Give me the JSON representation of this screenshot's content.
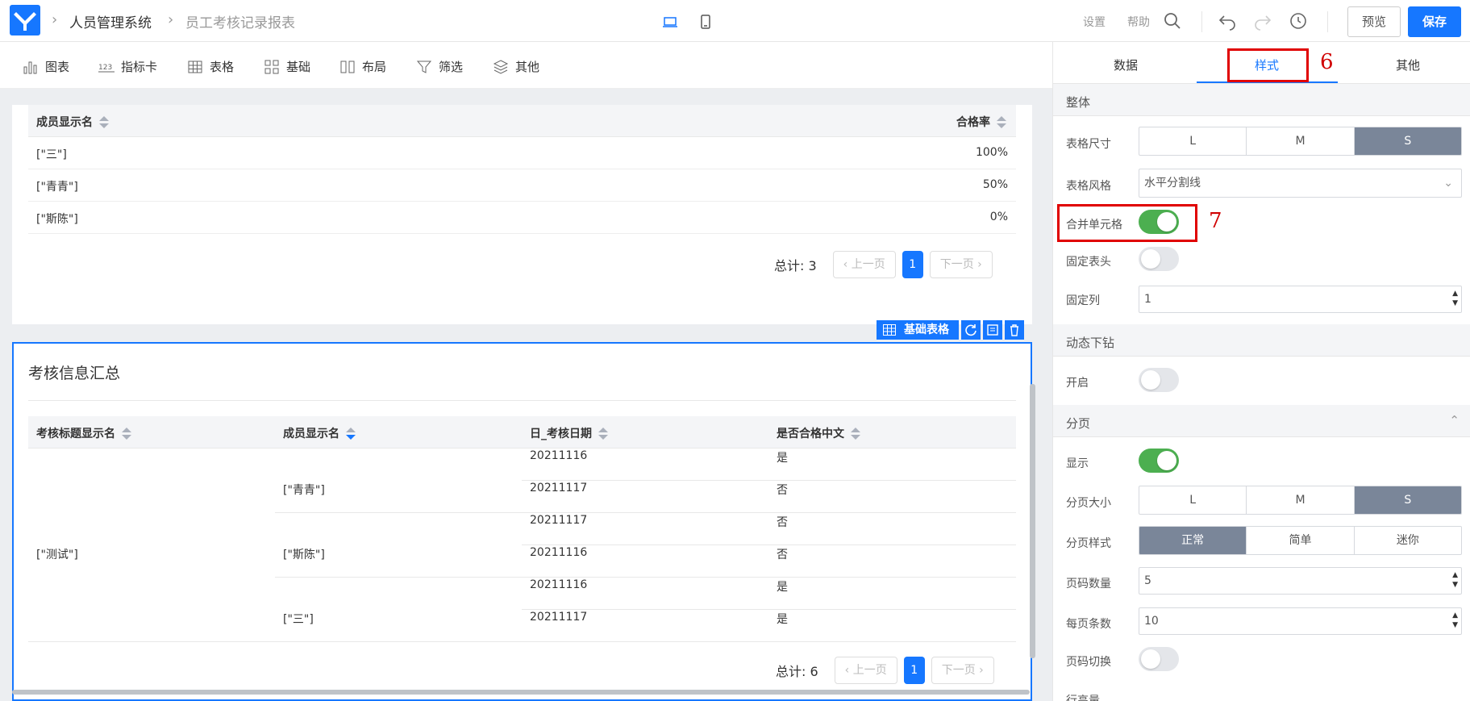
{
  "header": {
    "breadcrumb_app": "人员管理系统",
    "breadcrumb_page": "员工考核记录报表",
    "settings_label": "设置",
    "help_label": "帮助",
    "preview_label": "预览",
    "save_label": "保存"
  },
  "components": [
    {
      "label": "图表",
      "icon": "bar-chart-icon"
    },
    {
      "label": "指标卡",
      "icon": "number-123-icon"
    },
    {
      "label": "表格",
      "icon": "table-grid-icon"
    },
    {
      "label": "基础",
      "icon": "blocks-icon"
    },
    {
      "label": "布局",
      "icon": "columns-icon"
    },
    {
      "label": "筛选",
      "icon": "filter-icon"
    },
    {
      "label": "其他",
      "icon": "layers-icon"
    }
  ],
  "table1": {
    "columns": [
      "成员显示名",
      "合格率"
    ],
    "rows": [
      {
        "name": "[\"三\"]",
        "rate": "100%"
      },
      {
        "name": "[\"青青\"]",
        "rate": "50%"
      },
      {
        "name": "[\"斯陈\"]",
        "rate": "0%"
      }
    ],
    "total": "总计: 3",
    "prev": "上一页",
    "next": "下一页",
    "page": "1"
  },
  "table2": {
    "title": "考核信息汇总",
    "tag_label": "基础表格",
    "columns": [
      "考核标题显示名",
      "成员显示名",
      "日_考核日期",
      "是否合格中文"
    ],
    "group": "[\"测试\"]",
    "members": [
      "[\"青青\"]",
      "[\"斯陈\"]",
      "[\"三\"]"
    ],
    "dates": [
      "20211116",
      "20211117",
      "20211117",
      "20211116",
      "20211116",
      "20211117"
    ],
    "passed": [
      "是",
      "否",
      "否",
      "否",
      "是",
      "是"
    ],
    "total": "总计: 6",
    "prev": "上一页",
    "next": "下一页",
    "page": "1"
  },
  "panel": {
    "tabs": [
      "数据",
      "样式",
      "其他"
    ],
    "sec_overall": "整体",
    "table_size_label": "表格尺寸",
    "size_options": [
      "L",
      "M",
      "S"
    ],
    "table_style_label": "表格风格",
    "table_style_value": "水平分割线",
    "merge_cells_label": "合并单元格",
    "fixed_header_label": "固定表头",
    "fixed_col_label": "固定列",
    "fixed_col_value": "1",
    "sec_drill": "动态下钻",
    "drill_enable_label": "开启",
    "sec_paging": "分页",
    "show_label": "显示",
    "page_size_label": "分页大小",
    "page_style_label": "分页样式",
    "page_style_options": [
      "正常",
      "简单",
      "迷你"
    ],
    "page_count_label": "页码数量",
    "page_count_value": "5",
    "per_page_label": "每页条数",
    "per_page_value": "10",
    "page_switch_label": "页码切换",
    "row_height_label": "行高量"
  },
  "annotations": {
    "a6": "6",
    "a7": "7"
  },
  "colors": {
    "accent": "#1677ff",
    "toggle_on": "#4caf50",
    "segment_active": "#7a8699",
    "highlight": "#e00000"
  }
}
